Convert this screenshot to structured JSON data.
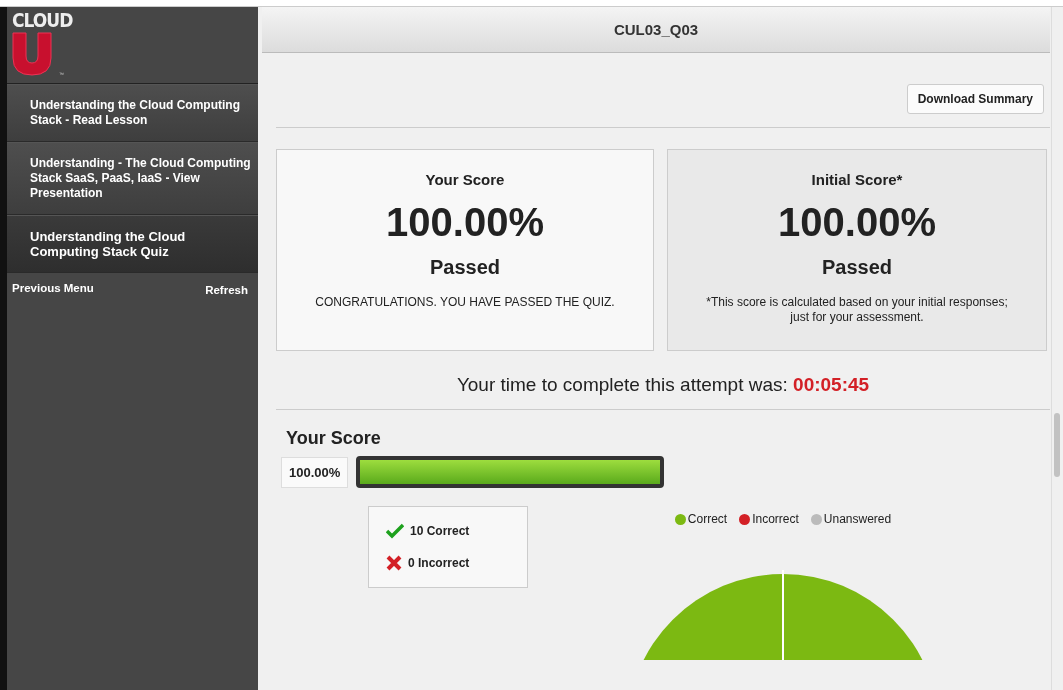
{
  "logo": {
    "word": "CLOUD",
    "mark": "™"
  },
  "sidebar": {
    "items": [
      {
        "label": "Understanding the Cloud Computing Stack - Read Lesson",
        "selected": false
      },
      {
        "label": "Understanding - The Cloud Computing Stack SaaS, PaaS, IaaS - View Presentation",
        "selected": false
      },
      {
        "label": "Understanding the Cloud Computing Stack Quiz",
        "selected": true
      }
    ],
    "previous": "Previous Menu",
    "refresh": "Refresh"
  },
  "header": {
    "title": "CUL03_Q03"
  },
  "download_button": "Download Summary",
  "cards": [
    {
      "title": "Your Score",
      "score": "100.00%",
      "status": "Passed",
      "note": "CONGRATULATIONS. YOU HAVE PASSED THE QUIZ.",
      "shaded": false
    },
    {
      "title": "Initial Score*",
      "score": "100.00%",
      "status": "Passed",
      "note": "*This score is calculated based on your initial responses; just for your assessment.",
      "shaded": true
    }
  ],
  "time": {
    "label": "Your time to complete this attempt was:",
    "value": "00:05:45"
  },
  "score_section": {
    "heading": "Your Score",
    "percent": "100.00%",
    "level": 1.0,
    "tally": [
      {
        "kind": "correct",
        "label": "10 Correct"
      },
      {
        "kind": "incorrect",
        "label": "0 Incorrect"
      }
    ],
    "legend": [
      {
        "label": "Correct",
        "color": "#7cb912"
      },
      {
        "label": "Incorrect",
        "color": "#d32026"
      },
      {
        "label": "Unanswered",
        "color": "#bbbbbb"
      }
    ]
  }
}
